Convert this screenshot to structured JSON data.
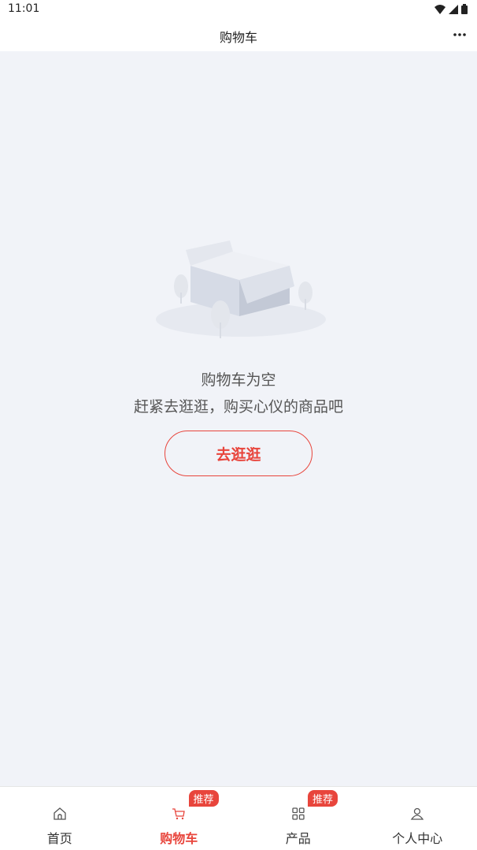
{
  "status_bar": {
    "time": "11:01"
  },
  "header": {
    "title": "购物车"
  },
  "empty_state": {
    "title": "购物车为空",
    "subtitle": "赶紧去逛逛，购买心仪的商品吧",
    "button_label": "去逛逛"
  },
  "tabbar": {
    "items": [
      {
        "label": "首页",
        "icon": "home-icon",
        "active": false,
        "badge": ""
      },
      {
        "label": "购物车",
        "icon": "cart-icon",
        "active": true,
        "badge": "推荐"
      },
      {
        "label": "产品",
        "icon": "grid-icon",
        "active": false,
        "badge": "推荐"
      },
      {
        "label": "个人中心",
        "icon": "user-icon",
        "active": false,
        "badge": ""
      }
    ]
  },
  "colors": {
    "accent": "#e8453c",
    "background": "#f1f3f8"
  }
}
